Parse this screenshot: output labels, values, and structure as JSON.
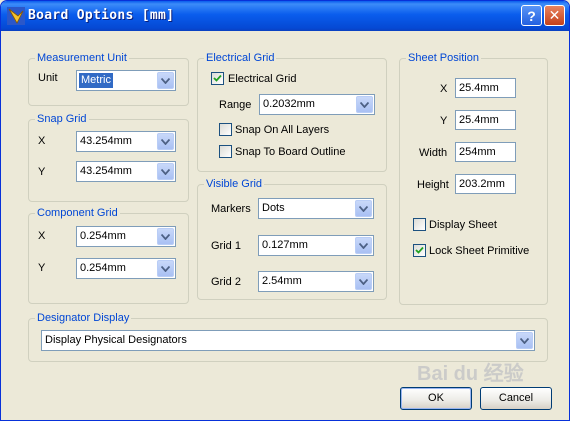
{
  "window": {
    "title": "Board Options [mm]",
    "help_label": "?",
    "close_label": "✕"
  },
  "measurement_unit": {
    "legend": "Measurement Unit",
    "unit_label": "Unit",
    "unit_value": "Metric"
  },
  "snap_grid": {
    "legend": "Snap Grid",
    "x_label": "X",
    "x_value": "43.254mm",
    "y_label": "Y",
    "y_value": "43.254mm"
  },
  "component_grid": {
    "legend": "Component Grid",
    "x_label": "X",
    "x_value": "0.254mm",
    "y_label": "Y",
    "y_value": "0.254mm"
  },
  "electrical_grid": {
    "legend": "Electrical Grid",
    "enable_label": "Electrical Grid",
    "enable_checked": true,
    "range_label": "Range",
    "range_value": "0.2032mm",
    "snap_all_layers_label": "Snap On All Layers",
    "snap_all_layers_checked": false,
    "snap_board_outline_label": "Snap To Board Outline",
    "snap_board_outline_checked": false
  },
  "visible_grid": {
    "legend": "Visible Grid",
    "markers_label": "Markers",
    "markers_value": "Dots",
    "grid1_label": "Grid 1",
    "grid1_value": "0.127mm",
    "grid2_label": "Grid 2",
    "grid2_value": "2.54mm"
  },
  "sheet_position": {
    "legend": "Sheet Position",
    "x_label": "X",
    "x_value": "25.4mm",
    "y_label": "Y",
    "y_value": "25.4mm",
    "width_label": "Width",
    "width_value": "254mm",
    "height_label": "Height",
    "height_value": "203.2mm",
    "display_sheet_label": "Display Sheet",
    "display_sheet_checked": false,
    "lock_primitive_label": "Lock Sheet Primitive",
    "lock_primitive_checked": true
  },
  "designator_display": {
    "legend": "Designator Display",
    "value": "Display Physical Designators"
  },
  "buttons": {
    "ok_label": "OK",
    "cancel_label": "Cancel"
  },
  "watermark_text": "Bai du 经验",
  "colors": {
    "legend_blue": "#0046d5",
    "face": "#ece9d8",
    "title_blue": "#0a5ded"
  }
}
